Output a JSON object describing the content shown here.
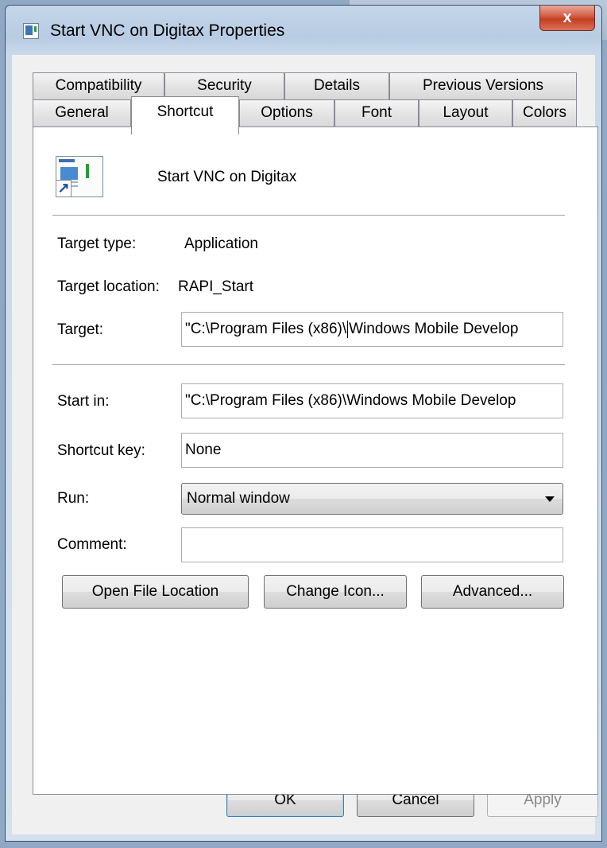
{
  "window": {
    "title": "Start VNC on Digitax Properties",
    "close_symbol": "x"
  },
  "tabs": {
    "row1": [
      "Compatibility",
      "Security",
      "Details",
      "Previous Versions"
    ],
    "row2": [
      "General",
      "Shortcut",
      "Options",
      "Font",
      "Layout",
      "Colors"
    ],
    "active": "Shortcut"
  },
  "shortcut": {
    "name": "Start VNC on Digitax",
    "target_type_label": "Target type:",
    "target_type_value": "Application",
    "target_location_label": "Target location:",
    "target_location_value": "RAPI_Start",
    "target_label": "Target:",
    "target_value_before_caret": "\"C:\\Program Files (x86)\\",
    "target_value_after_caret": "Windows Mobile Develop",
    "start_in_label": "Start in:",
    "start_in_value": "\"C:\\Program Files (x86)\\Windows Mobile Develop",
    "shortcut_key_label": "Shortcut key:",
    "shortcut_key_value": "None",
    "run_label": "Run:",
    "run_value": "Normal window",
    "comment_label": "Comment:",
    "comment_value": ""
  },
  "buttons": {
    "open_file_location": "Open File Location",
    "change_icon": "Change Icon...",
    "advanced": "Advanced...",
    "ok": "OK",
    "cancel": "Cancel",
    "apply": "Apply"
  }
}
